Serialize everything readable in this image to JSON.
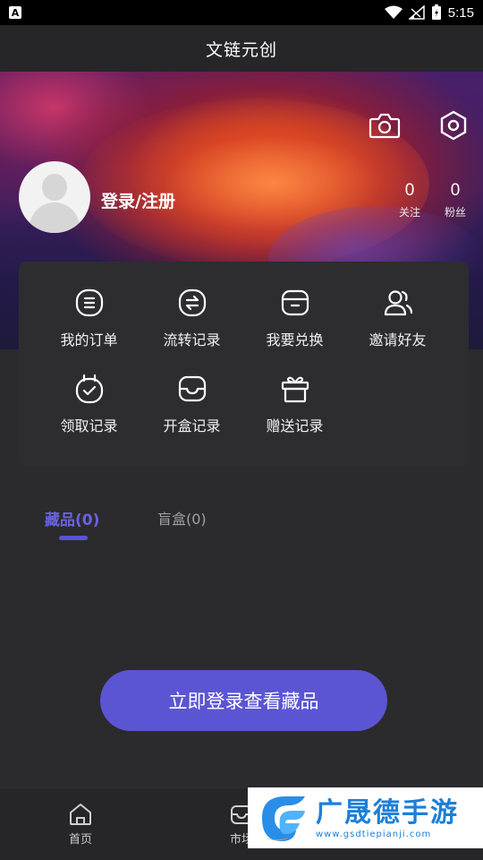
{
  "status_bar": {
    "time": "5:15",
    "left_icon": "A"
  },
  "header": {
    "title": "文链元创"
  },
  "profile": {
    "login_text": "登录/注册",
    "stats": [
      {
        "value": "0",
        "label": "关注"
      },
      {
        "value": "0",
        "label": "粉丝"
      }
    ],
    "icons": [
      "camera-icon",
      "settings-icon"
    ]
  },
  "menu": {
    "items": [
      {
        "label": "我的订单",
        "icon": "order-icon"
      },
      {
        "label": "流转记录",
        "icon": "transfer-icon"
      },
      {
        "label": "我要兑换",
        "icon": "exchange-icon"
      },
      {
        "label": "邀请好友",
        "icon": "invite-icon"
      },
      {
        "label": "领取记录",
        "icon": "receive-icon"
      },
      {
        "label": "开盒记录",
        "icon": "open-box-icon"
      },
      {
        "label": "赠送记录",
        "icon": "gift-icon"
      }
    ]
  },
  "collection": {
    "tabs": [
      {
        "label": "藏品(0)",
        "active": true
      },
      {
        "label": "盲盒(0)",
        "active": false
      }
    ],
    "login_button": "立即登录查看藏品"
  },
  "bottom_nav": {
    "items": [
      {
        "label": "首页",
        "icon": "home-icon"
      },
      {
        "label": "市场",
        "icon": "market-icon"
      }
    ]
  },
  "watermark": {
    "title": "广晟德手游",
    "url": "www.gsdtiepianji.com"
  },
  "colors": {
    "accent": "#5b55d3",
    "tab_active": "#6a62e0",
    "background": "#2b2b2d"
  }
}
